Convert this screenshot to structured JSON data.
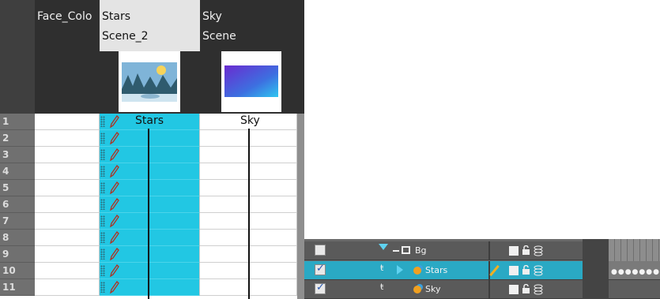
{
  "xsheet": {
    "columns": [
      {
        "name": "Face_Colo",
        "sub": ""
      },
      {
        "name": "Stars",
        "sub": "Scene_2"
      },
      {
        "name": "Sky",
        "sub": "Scene"
      }
    ],
    "frames": [
      "1",
      "2",
      "3",
      "4",
      "5",
      "6",
      "7",
      "8",
      "9",
      "10",
      "11"
    ],
    "cells": {
      "stars_first": "Stars",
      "sky_first": "Sky"
    }
  },
  "timeline": {
    "layers": [
      {
        "name": "Bg",
        "checked": false
      },
      {
        "name": "Stars",
        "checked": true
      },
      {
        "name": "Sky",
        "checked": true
      }
    ]
  },
  "colors": {
    "selection": "#22c7e3",
    "header_dark": "#2f2f2f",
    "frame_num_bg": "#707070"
  }
}
